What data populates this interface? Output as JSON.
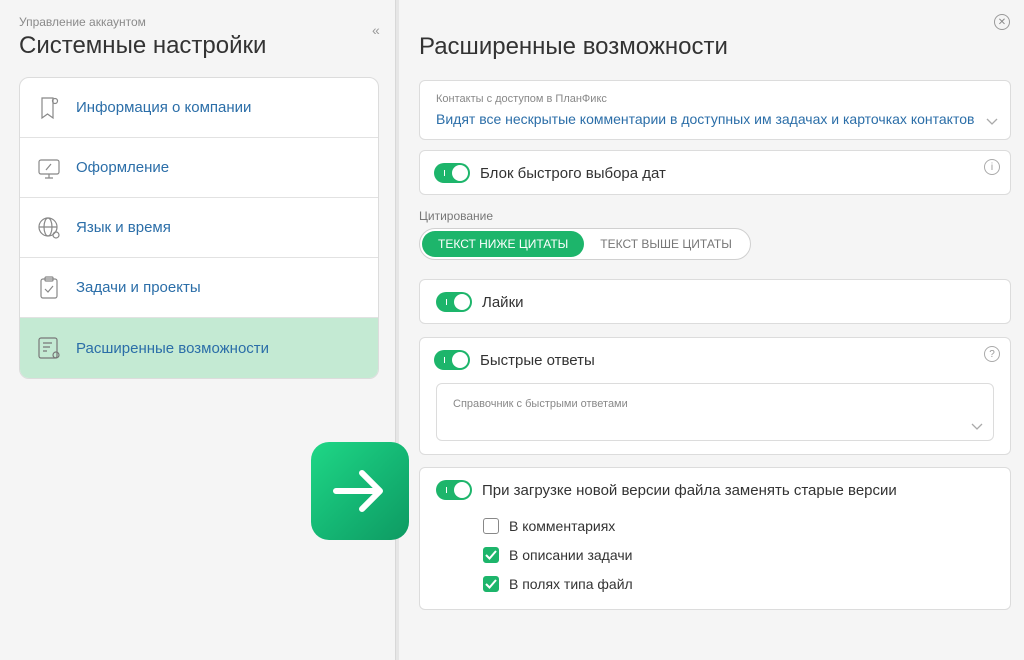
{
  "left": {
    "subtitle": "Управление аккаунтом",
    "title": "Системные настройки",
    "collapse_glyph": "«",
    "items": [
      {
        "label": "Информация о компании",
        "icon": "company-badge-icon"
      },
      {
        "label": "Оформление",
        "icon": "monitor-pen-icon"
      },
      {
        "label": "Язык и время",
        "icon": "globe-gear-icon"
      },
      {
        "label": "Задачи и проекты",
        "icon": "clipboard-check-icon"
      },
      {
        "label": "Расширенные возможности",
        "icon": "list-gear-icon",
        "active": true
      }
    ]
  },
  "right": {
    "title": "Расширенные возможности",
    "contacts": {
      "caption": "Контакты с доступом в ПланФикс",
      "value": "Видят все нескрытые комментарии в доступных им задачах и карточках контактов"
    },
    "date_block": {
      "label": "Блок быстрого выбора дат",
      "enabled": true
    },
    "citation": {
      "caption": "Цитирование",
      "options": [
        "ТЕКСТ НИЖЕ ЦИТАТЫ",
        "ТЕКСТ ВЫШЕ ЦИТАТЫ"
      ],
      "selected": 0
    },
    "likes": {
      "label": "Лайки",
      "enabled": true
    },
    "quick_replies": {
      "label": "Быстрые ответы",
      "enabled": true,
      "dict_caption": "Справочник с быстрыми ответами"
    },
    "file_versions": {
      "label": "При загрузке новой версии файла заменять старые версии",
      "enabled": true,
      "options": [
        {
          "label": "В комментариях",
          "checked": false
        },
        {
          "label": "В описании задачи",
          "checked": true
        },
        {
          "label": "В полях типа файл",
          "checked": true
        }
      ]
    }
  },
  "colors": {
    "accent": "#1db56b",
    "link": "#2b6ea8",
    "active_bg": "#c4ead3"
  }
}
